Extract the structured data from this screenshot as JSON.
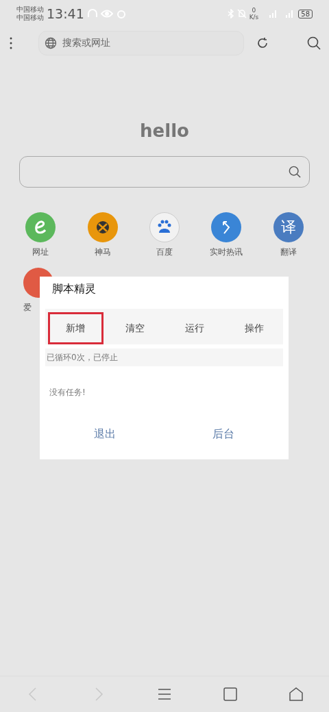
{
  "status_bar": {
    "carriers": [
      "中国移动",
      "中国移动"
    ],
    "time": "13:41",
    "speed": [
      "0",
      "K/s"
    ],
    "battery": "58"
  },
  "toolbar": {
    "address_placeholder": "搜索或网址"
  },
  "home": {
    "logo": "hello",
    "shortcuts": [
      {
        "label": "网址",
        "kind": "e",
        "color": "#5cb85c"
      },
      {
        "label": "神马",
        "kind": "xbox",
        "color": "#e8960c"
      },
      {
        "label": "百度",
        "kind": "paw",
        "color": "#f2f2f2"
      },
      {
        "label": "实时热讯",
        "kind": "arrow",
        "color": "#3a85d6"
      },
      {
        "label": "翻译",
        "kind": "glyph",
        "glyph": "译",
        "color": "#4a7cc0"
      },
      {
        "label": "爱",
        "kind": "plain",
        "color": "#e05a44",
        "covered": true
      }
    ]
  },
  "dialog": {
    "title": "脚本精灵",
    "tabs": [
      {
        "label": "新增",
        "selected": true
      },
      {
        "label": "清空",
        "selected": false
      },
      {
        "label": "运行",
        "selected": false
      },
      {
        "label": "操作",
        "selected": false
      }
    ],
    "status": "已循环0次，已停止",
    "empty_text": "没有任务!",
    "buttons": [
      "退出",
      "后台"
    ]
  },
  "bottom_nav": [
    {
      "kind": "back",
      "disabled": true
    },
    {
      "kind": "forward",
      "disabled": true
    },
    {
      "kind": "menu",
      "disabled": false
    },
    {
      "kind": "tabs",
      "disabled": false
    },
    {
      "kind": "home",
      "disabled": false
    }
  ]
}
